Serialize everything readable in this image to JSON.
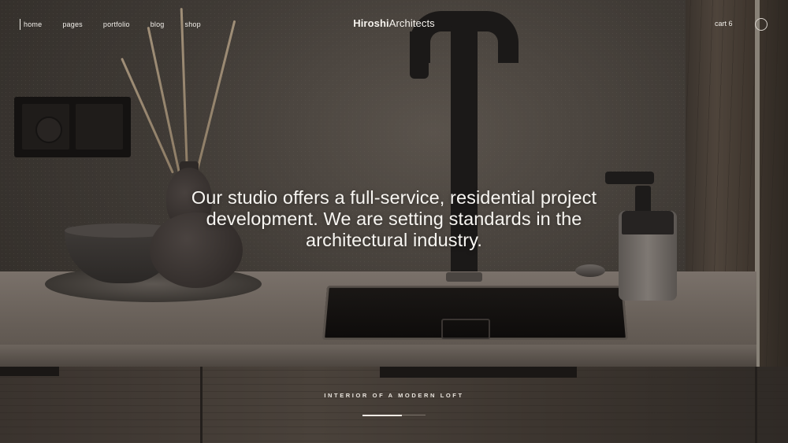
{
  "nav": {
    "items": [
      {
        "label": "home"
      },
      {
        "label": "pages"
      },
      {
        "label": "portfolio"
      },
      {
        "label": "blog"
      },
      {
        "label": "shop"
      }
    ]
  },
  "brand": {
    "bold": "Hiroshi",
    "light": "Architects"
  },
  "cart": {
    "label": "cart 6"
  },
  "hero": {
    "headline": "Our studio offers a full-service, residential project development. We are setting standards in the architectural industry.",
    "caption": "INTERIOR OF A MODERN LOFT"
  },
  "slider": {
    "progress": 0.62
  },
  "colors": {
    "text": "#f7f5f1",
    "background": "#3f3a35"
  }
}
